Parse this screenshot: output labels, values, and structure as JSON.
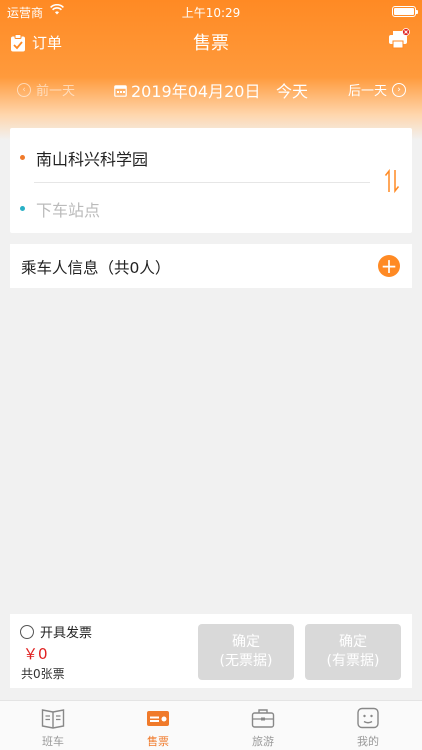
{
  "status_bar": {
    "carrier": "运营商",
    "time": "上午10:29"
  },
  "nav": {
    "orders_label": "订单",
    "title": "售票"
  },
  "date_bar": {
    "prev_label": "前一天",
    "date": "2019年04月20日",
    "today_label": "今天",
    "next_label": "后一天"
  },
  "stations": {
    "from": "南山科兴科学园",
    "to_placeholder": "下车站点"
  },
  "passengers": {
    "title": "乘车人信息（共0人）"
  },
  "checkout": {
    "invoice_label": "开具发票",
    "price": "￥0",
    "ticket_count": "共0张票",
    "confirm_no_receipt_line1": "确定",
    "confirm_no_receipt_line2": "(无票据)",
    "confirm_with_receipt_line1": "确定",
    "confirm_with_receipt_line2": "(有票据)"
  },
  "tabs": [
    {
      "label": "班车",
      "icon": "schedule-icon",
      "active": false
    },
    {
      "label": "售票",
      "icon": "ticket-icon",
      "active": true
    },
    {
      "label": "旅游",
      "icon": "briefcase-icon",
      "active": false
    },
    {
      "label": "我的",
      "icon": "profile-icon",
      "active": false
    }
  ],
  "colors": {
    "accent": "#ff8a24",
    "price_red": "#e02020",
    "teal_dot": "#29b0c5",
    "disabled_button": "#d9d9d9"
  }
}
